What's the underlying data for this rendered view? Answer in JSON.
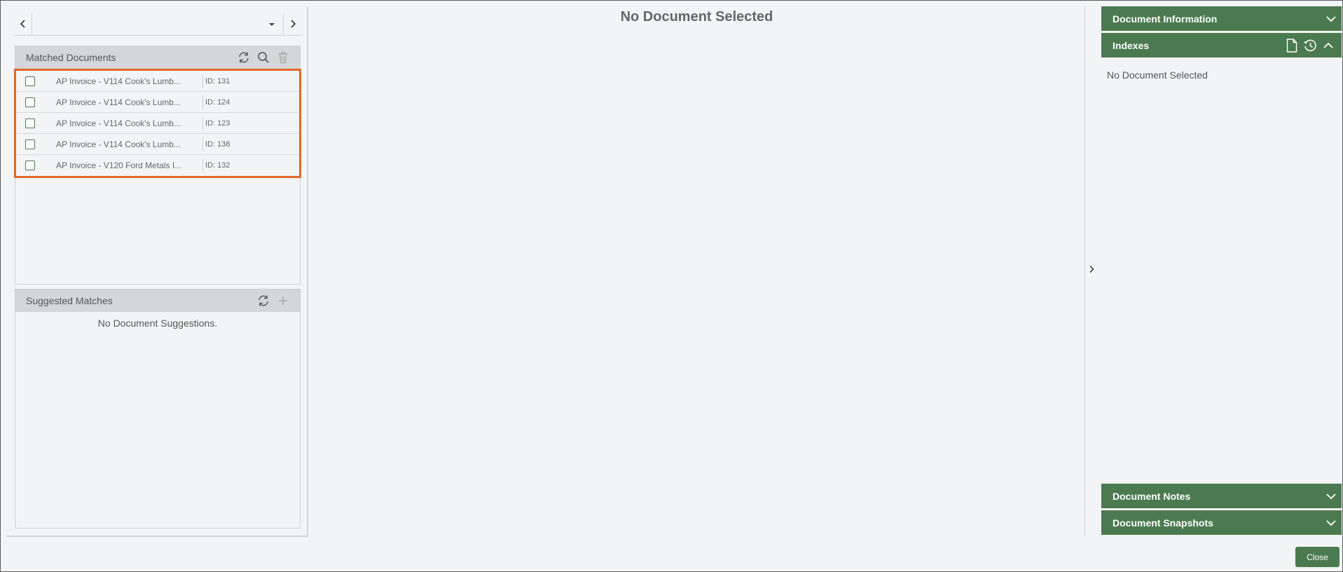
{
  "nav": {
    "selected_value": ""
  },
  "matched": {
    "title": "Matched Documents",
    "documents": [
      {
        "name": "AP Invoice - V114 Cook's Lumb...",
        "id_label": "ID:",
        "id": "131"
      },
      {
        "name": "AP Invoice - V114 Cook's Lumb...",
        "id_label": "ID:",
        "id": "124"
      },
      {
        "name": "AP Invoice - V114 Cook's Lumb...",
        "id_label": "ID:",
        "id": "123"
      },
      {
        "name": "AP Invoice - V114 Cook's Lumb...",
        "id_label": "ID:",
        "id": "138"
      },
      {
        "name": "AP Invoice - V120 Ford Metals I...",
        "id_label": "ID:",
        "id": "132"
      }
    ]
  },
  "suggested": {
    "title": "Suggested Matches",
    "empty_text": "No Document Suggestions."
  },
  "viewer": {
    "title": "No Document Selected"
  },
  "right": {
    "document_information": "Document Information",
    "indexes": "Indexes",
    "indexes_empty": "No Document Selected",
    "document_notes": "Document Notes",
    "document_snapshots": "Document Snapshots"
  },
  "footer": {
    "close_label": "Close"
  },
  "colors": {
    "accent_green": "#4b7a50",
    "highlight_orange": "#e0692b",
    "header_gray": "#d5d6d7"
  }
}
